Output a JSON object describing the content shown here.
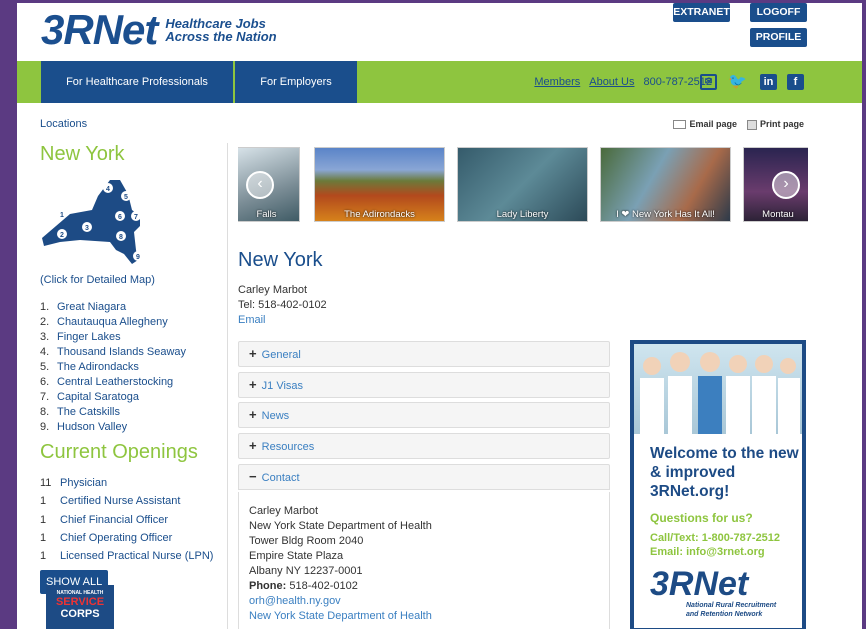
{
  "header": {
    "logo_text": "3RNet",
    "tagline_line1": "Healthcare Jobs",
    "tagline_line2": "Across the Nation",
    "extranet": "EXTRANET",
    "logoff": "LOGOFF",
    "profile": "PROFILE"
  },
  "nav": {
    "professionals": "For Healthcare Professionals",
    "employers": "For Employers",
    "members": "Members",
    "about": "About Us",
    "phone": "800-787-2512"
  },
  "breadcrumb": "Locations",
  "utility": {
    "email_page": "Email page",
    "print_page": "Print page"
  },
  "state_title": "New York",
  "map_caption": "(Click for Detailed Map)",
  "regions": [
    {
      "num": "1.",
      "name": "Great Niagara"
    },
    {
      "num": "2.",
      "name": "Chautauqua Allegheny"
    },
    {
      "num": "3.",
      "name": "Finger Lakes"
    },
    {
      "num": "4.",
      "name": "Thousand Islands Seaway"
    },
    {
      "num": "5.",
      "name": "The Adirondacks"
    },
    {
      "num": "6.",
      "name": "Central Leatherstocking"
    },
    {
      "num": "7.",
      "name": "Capital Saratoga"
    },
    {
      "num": "8.",
      "name": "The Catskills"
    },
    {
      "num": "9.",
      "name": "Hudson Valley"
    }
  ],
  "map_numbers": [
    "1",
    "2",
    "3",
    "4",
    "5",
    "6",
    "7",
    "8",
    "9"
  ],
  "openings_title": "Current Openings",
  "openings": [
    {
      "count": "11",
      "title": "Physician"
    },
    {
      "count": "1",
      "title": "Certified Nurse Assistant"
    },
    {
      "count": "1",
      "title": "Chief Financial Officer"
    },
    {
      "count": "1",
      "title": "Chief Operating Officer"
    },
    {
      "count": "1",
      "title": "Licensed Practical Nurse (LPN)"
    }
  ],
  "show_all": "SHOW ALL",
  "nhsc": {
    "line1": "NATIONAL HEALTH",
    "line2": "SERVICE",
    "line3": "CORPS"
  },
  "carousel": [
    "Falls",
    "The Adirondacks",
    "Lady Liberty",
    "I ❤ New York Has It All!",
    "Montau"
  ],
  "main_title": "New York",
  "contact": {
    "name": "Carley Marbot",
    "tel": "Tel: 518-402-0102",
    "email": "Email"
  },
  "accordion": [
    {
      "label": "General",
      "sign": "+"
    },
    {
      "label": "J1 Visas",
      "sign": "+"
    },
    {
      "label": "News",
      "sign": "+"
    },
    {
      "label": "Resources",
      "sign": "+"
    },
    {
      "label": "Contact",
      "sign": "−"
    }
  ],
  "contact_detail": {
    "name": "Carley Marbot",
    "org": "New York State Department of Health",
    "room": "Tower Bldg Room 2040",
    "plaza": "Empire State Plaza",
    "city": "Albany NY 12237-0001",
    "phone_label": "Phone:",
    "phone": "518-402-0102",
    "email": "orh@health.ny.gov",
    "link": "New York State Department of Health"
  },
  "ad": {
    "welcome": "Welcome to the new & improved 3RNet.org!",
    "questions": "Questions for us?",
    "call": "Call/Text: 1-800-787-2512",
    "email": "Email: info@3rnet.org",
    "logo": "3RNet",
    "sub1": "National Rural Recruitment",
    "sub2": "and Retention Network"
  },
  "colors": {
    "brand_blue": "#1a4e8c",
    "brand_green": "#8ec53f",
    "frame_purple": "#5b3a82"
  }
}
